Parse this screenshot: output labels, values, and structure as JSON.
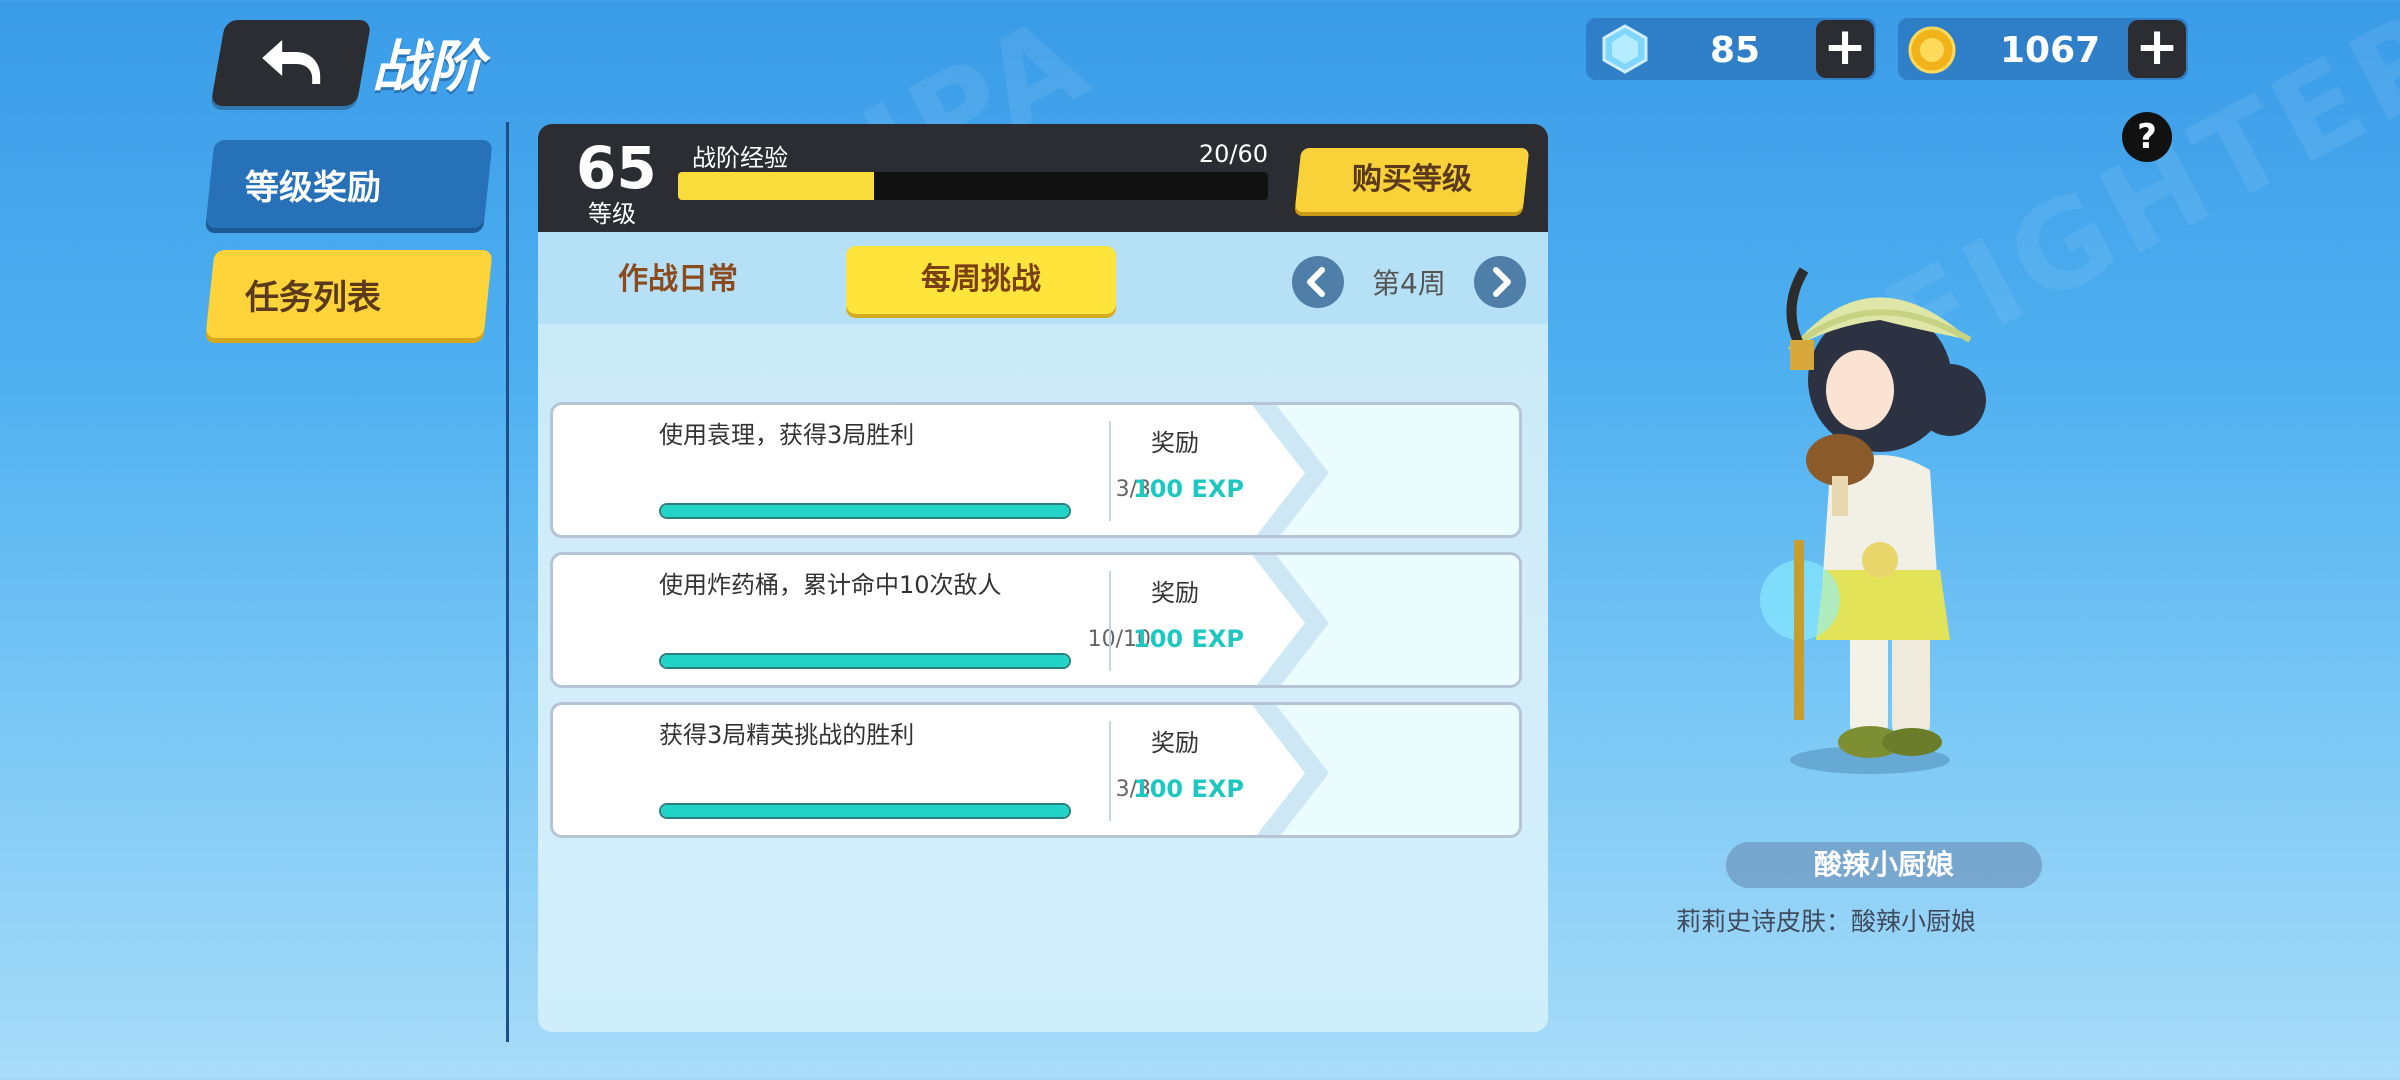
{
  "header": {
    "title": "战阶"
  },
  "currency": {
    "gems": "85",
    "coins": "1067",
    "plus_symbol": "+"
  },
  "help_label": "?",
  "sidebar": {
    "items": [
      {
        "label": "等级奖励",
        "active": false
      },
      {
        "label": "任务列表",
        "active": true
      }
    ]
  },
  "level": {
    "number": "65",
    "label": "等级",
    "exp_label": "战阶经验",
    "exp_text": "20/60",
    "exp_progress": 0.333,
    "buy_label": "购买等级"
  },
  "tabs": {
    "daily": "作战日常",
    "weekly": "每周挑战",
    "week_label": "第4周"
  },
  "tasks": [
    {
      "title": "使用袁理，获得3局胜利",
      "count": "3/3",
      "progress": 1.0,
      "reward_label": "奖励",
      "reward_value": "100 EXP"
    },
    {
      "title": "使用炸药桶，累计命中10次敌人",
      "count": "10/10",
      "progress": 1.0,
      "reward_label": "奖励",
      "reward_value": "100 EXP"
    },
    {
      "title": "获得3局精英挑战的胜利",
      "count": "3/3",
      "progress": 1.0,
      "reward_label": "奖励",
      "reward_value": "100 EXP"
    }
  ],
  "character": {
    "name": "酸辣小厨娘",
    "description": "莉莉史诗皮肤：酸辣小厨娘"
  },
  "colors": {
    "accent_yellow": "#ffd43b",
    "progress_teal": "#22d3c8",
    "dark_panel": "#2b2d33"
  }
}
